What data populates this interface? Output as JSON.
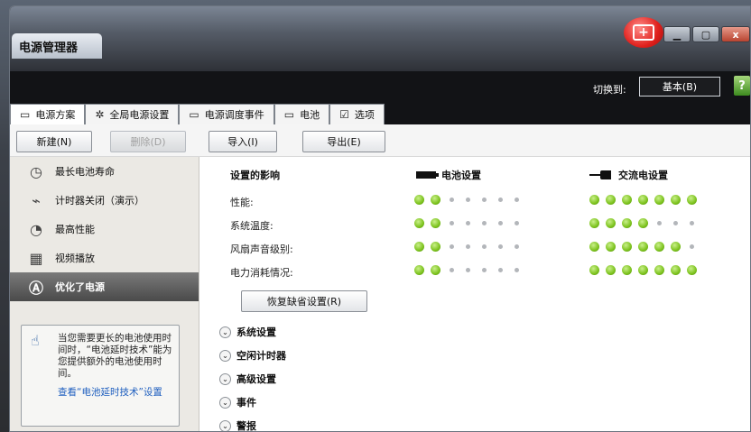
{
  "window": {
    "title": "电源管理器"
  },
  "toolbar": {
    "switch_label": "切换到:",
    "switch_button": "基本(B)",
    "help_glyph": "?"
  },
  "tabs": [
    {
      "label": "电源方案",
      "icon": "plan-tab-icon"
    },
    {
      "label": "全局电源设置",
      "icon": "gear-icon"
    },
    {
      "label": "电源调度事件",
      "icon": "schedule-icon"
    },
    {
      "label": "电池",
      "icon": "battery-icon"
    },
    {
      "label": "选项",
      "icon": "checkbox-icon"
    }
  ],
  "actions": {
    "new": "新建(N)",
    "delete": "删除(D)",
    "import": "导入(I)",
    "export": "导出(E)"
  },
  "plans": [
    {
      "label": "最长电池寿命",
      "icon": "battery-life-icon"
    },
    {
      "label": "计时器关闭（演示）",
      "icon": "timer-off-icon"
    },
    {
      "label": "最高性能",
      "icon": "performance-icon"
    },
    {
      "label": "视频播放",
      "icon": "video-icon"
    },
    {
      "label": "优化了电源",
      "icon": "optimized-power-icon",
      "active": true
    }
  ],
  "tip": {
    "text": "当您需要更长的电池使用时间时，“电池延时技术”能为您提供额外的电池使用时间。",
    "link": "查看“电池延时技术”设置"
  },
  "settings": {
    "impact_header": "设置的影响",
    "battery_header": "电池设置",
    "ac_header": "交流电设置",
    "rows": [
      {
        "label": "性能:",
        "battery_level": 2,
        "ac_level": 7
      },
      {
        "label": "系统温度:",
        "battery_level": 2,
        "ac_level": 4
      },
      {
        "label": "风扇声音级别:",
        "battery_level": 2,
        "ac_level": 6
      },
      {
        "label": "电力消耗情况:",
        "battery_level": 2,
        "ac_level": 7
      }
    ],
    "scale_max": 7,
    "restore_button": "恢复缺省设置(R)"
  },
  "sections": [
    "系统设置",
    "空闲计时器",
    "高级设置",
    "事件",
    "警报"
  ]
}
